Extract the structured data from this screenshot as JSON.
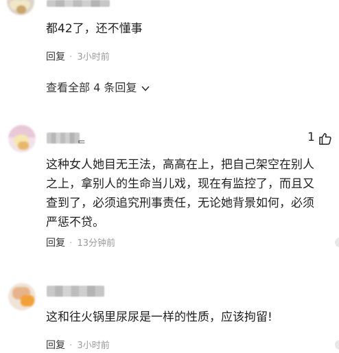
{
  "comments": [
    {
      "text_lines": [
        "都42了，还不懂事"
      ],
      "reply_label": "回复",
      "time": "3小时前"
    },
    {
      "text_lines": [
        "这种女人她目无王法，高高在上，把自己架空在别人",
        "之上，拿别人的生命当儿戏，现在有监控了，而且又",
        "查到了，必须追究刑事责任，无论她背景如何，必须",
        "严惩不贷。"
      ],
      "reply_label": "回复",
      "time": "13分钟前",
      "likes": "1"
    },
    {
      "text_lines": [
        "这和往火锅里尿尿是一样的性质，应该拘留!"
      ],
      "reply_label": "回复",
      "time": "3小时前"
    }
  ],
  "view_all_label": "查看全部 4 条回复",
  "icons": {
    "expand": "chevron-down-icon",
    "like": "thumbs-up-icon"
  },
  "colors": {
    "text": "#1f1f1f",
    "meta": "#9a9a9a",
    "background": "#ffffff"
  }
}
